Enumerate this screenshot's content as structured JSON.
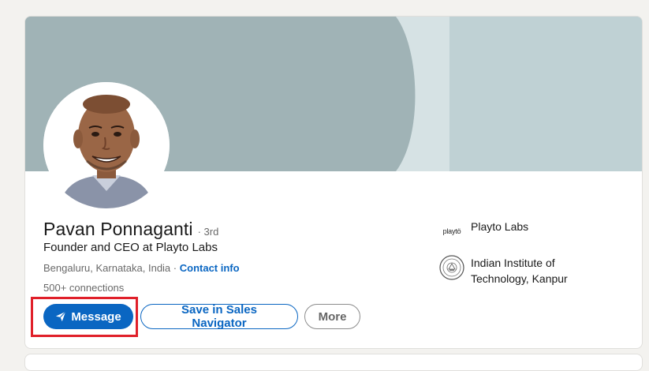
{
  "profile": {
    "name": "Pavan Ponnaganti",
    "degree": "· 3rd",
    "headline": "Founder and CEO at Playto Labs",
    "location": "Bengaluru, Karnataka, India",
    "location_separator": " · ",
    "contact_info": "Contact info",
    "connections": "500+ connections"
  },
  "actions": {
    "message": "Message",
    "save_sales_navigator": "Save in Sales Navigator",
    "more": "More"
  },
  "orgs": [
    {
      "logo_text": "playtö",
      "name": "Playto Labs"
    },
    {
      "logo_text": "",
      "name": "Indian Institute of Technology, Kanpur"
    }
  ],
  "colors": {
    "primary": "#0a66c2",
    "banner_light": "#bfd1d4",
    "banner_dark": "#a0b3b6",
    "highlight": "#e0202a"
  },
  "icons": {
    "send": "send-icon",
    "iit_logo": "iit-kanpur-logo-icon"
  }
}
